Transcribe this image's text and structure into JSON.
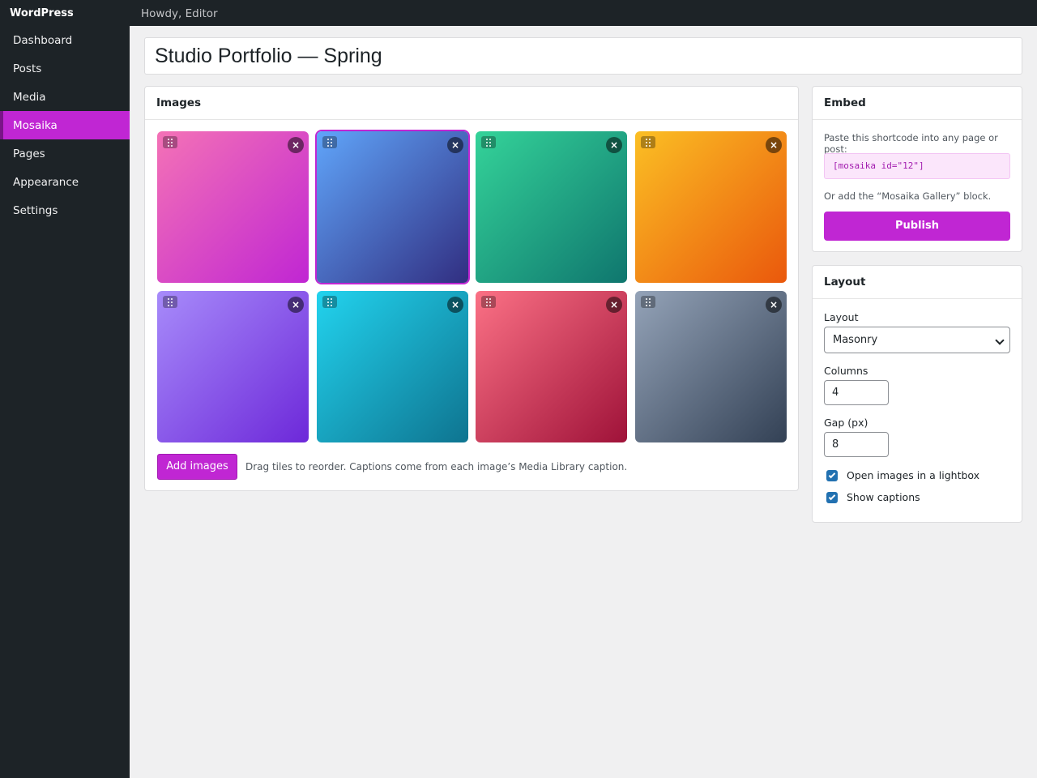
{
  "app": {
    "brand": "WordPress",
    "greeting": "Howdy, Editor"
  },
  "sidebar": {
    "items": [
      {
        "label": "Dashboard"
      },
      {
        "label": "Posts"
      },
      {
        "label": "Media"
      },
      {
        "label": "Mosaika",
        "active": true
      },
      {
        "label": "Pages"
      },
      {
        "label": "Appearance"
      },
      {
        "label": "Settings"
      }
    ]
  },
  "gallery": {
    "title": "Studio Portfolio — Spring",
    "images_heading": "Images",
    "tiles": [
      {
        "from": "#f472b6",
        "to": "#c026d3",
        "close": "×",
        "selected": false
      },
      {
        "from": "#60a5fa",
        "to": "#312e81",
        "close": "×",
        "selected": true
      },
      {
        "from": "#34d399",
        "to": "#0f766e",
        "close": "×",
        "selected": false
      },
      {
        "from": "#fbbf24",
        "to": "#ea580c",
        "close": "×",
        "selected": false
      },
      {
        "from": "#a78bfa",
        "to": "#6d28d9",
        "close": "×",
        "selected": false
      },
      {
        "from": "#22d3ee",
        "to": "#0e7490",
        "close": "×",
        "selected": false
      },
      {
        "from": "#fb7185",
        "to": "#9f1239",
        "close": "×",
        "selected": false
      },
      {
        "from": "#94a3b8",
        "to": "#334155",
        "close": "×",
        "selected": false
      }
    ],
    "add_images_label": "Add images",
    "hint": "Drag tiles to reorder. Captions come from each image’s Media Library caption."
  },
  "embed": {
    "heading": "Embed",
    "instructions": "Paste this shortcode into any page or post:",
    "shortcode": "[mosaika id=\"12\"]",
    "alt_text": "Or add the “Mosaika Gallery” block.",
    "publish_label": "Publish"
  },
  "layout": {
    "heading": "Layout",
    "layout_label": "Layout",
    "layout_value": "Masonry",
    "columns_label": "Columns",
    "columns_value": "4",
    "gap_label": "Gap (px)",
    "gap_value": "8",
    "lightbox_label": "Open images in a lightbox",
    "lightbox_checked": true,
    "captions_label": "Show captions",
    "captions_checked": true
  },
  "colors": {
    "accent": "#c026d3",
    "sidebar_bg": "#1d2327",
    "checkbox": "#2271b1"
  },
  "icons": {
    "tile_handle": "drag-handle-icon",
    "tile_remove": "close-icon",
    "select": "chevron-down-icon"
  }
}
